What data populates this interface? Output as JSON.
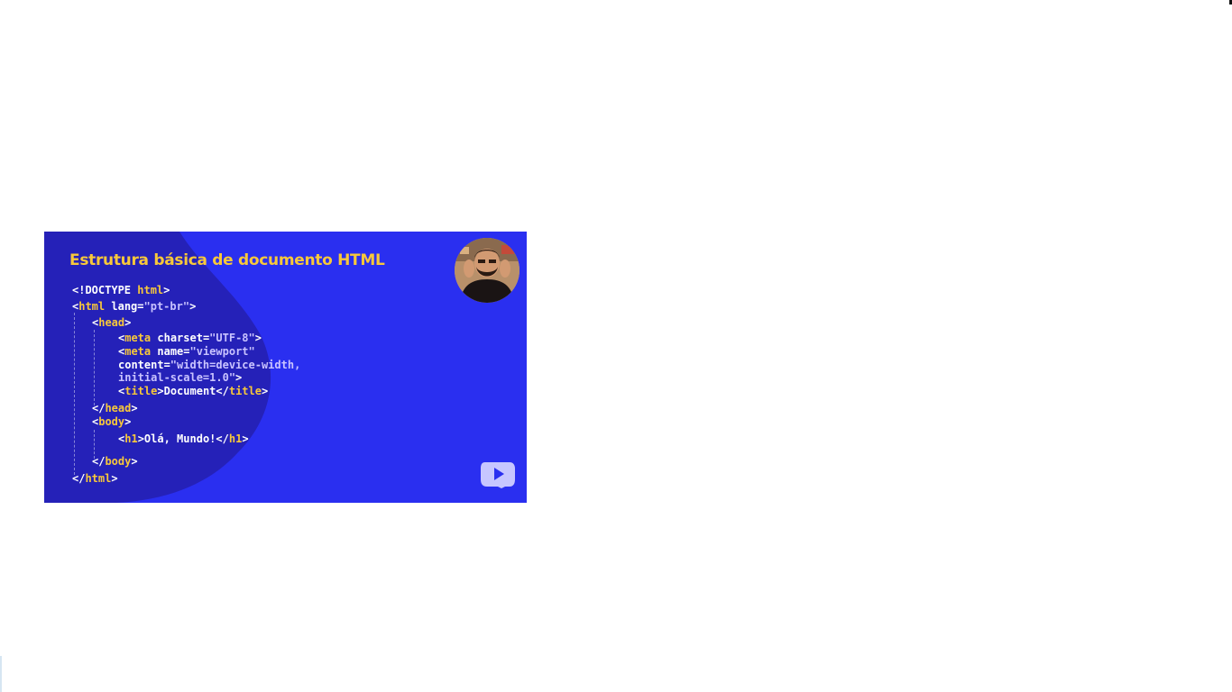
{
  "video": {
    "slide_title": "Estrutura básica de documento HTML",
    "code": {
      "doctype": "<!DOCTYPE ",
      "doctype_kw": "html",
      "doctype_end": ">",
      "html_open_lt": "<",
      "html_open_tag": "html",
      "html_open_attr": " lang=",
      "html_open_val": "\"pt-br\"",
      "html_open_gt": ">",
      "head_lt": "<",
      "head_tag": "head",
      "head_gt": ">",
      "meta1_lt": "<",
      "meta1_tag": "meta",
      "meta1_attr": " charset=",
      "meta1_val": "\"UTF-8\"",
      "meta1_gt": ">",
      "meta2_lt": "<",
      "meta2_tag": "meta",
      "meta2_attr": " name=",
      "meta2_val": "\"viewport\"",
      "meta2_cont_attr": "content=",
      "meta2_cont_val1": "\"width=device-width,",
      "meta2_cont_val2": "initial-scale=1.0\"",
      "meta2_gt": ">",
      "title_lt": "<",
      "title_tag": "title",
      "title_gt": ">",
      "title_text": "Document",
      "title_close_lt": "</",
      "title_close_tag": "title",
      "title_close_gt": ">",
      "head_close_lt": "</",
      "head_close_tag": "head",
      "head_close_gt": ">",
      "body_lt": "<",
      "body_tag": "body",
      "body_gt": ">",
      "h1_lt": "<",
      "h1_tag": "h1",
      "h1_gt": ">",
      "h1_text": "Olá, Mundo!",
      "h1_close_lt": "</",
      "h1_close_tag": "h1",
      "h1_close_gt": ">",
      "body_close_lt": "</",
      "body_close_tag": "body",
      "body_close_gt": ">",
      "html_close_lt": "</",
      "html_close_tag": "html",
      "html_close_gt": ">"
    },
    "icons": {
      "avatar": "presenter-avatar",
      "play": "play-icon"
    },
    "colors": {
      "background": "#2a2ff0",
      "blob": "#2521b8",
      "title": "#f8c83a",
      "tag": "#f8c83a",
      "string": "#c9c3ff",
      "text": "#ffffff"
    }
  }
}
